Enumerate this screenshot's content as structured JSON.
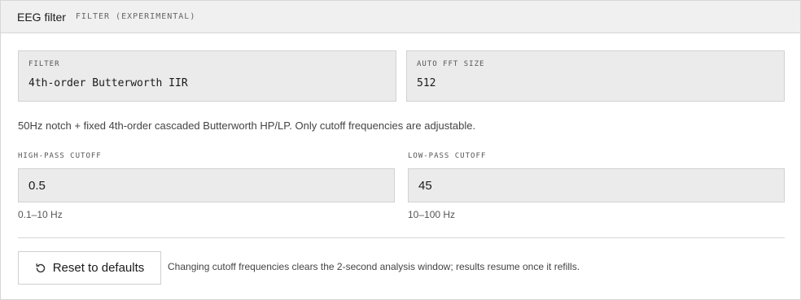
{
  "header": {
    "title": "EEG filter",
    "subtitle": "FILTER (EXPERIMENTAL)"
  },
  "readonly": {
    "filter": {
      "label": "FILTER",
      "value": "4th-order Butterworth IIR"
    },
    "fft": {
      "label": "AUTO FFT SIZE",
      "value": "512"
    }
  },
  "description": "50Hz notch + fixed 4th-order cascaded Butterworth HP/LP. Only cutoff frequencies are adjustable.",
  "highpass": {
    "label": "HIGH-PASS CUTOFF",
    "value": "0.5",
    "hint": "0.1–10 Hz"
  },
  "lowpass": {
    "label": "LOW-PASS CUTOFF",
    "value": "45",
    "hint": "10–100 Hz"
  },
  "actions": {
    "reset_label": "Reset to defaults",
    "reset_icon": "rotate-ccw-icon"
  },
  "footer_note": "Changing cutoff frequencies clears the 2-second analysis window; results resume once it refills."
}
